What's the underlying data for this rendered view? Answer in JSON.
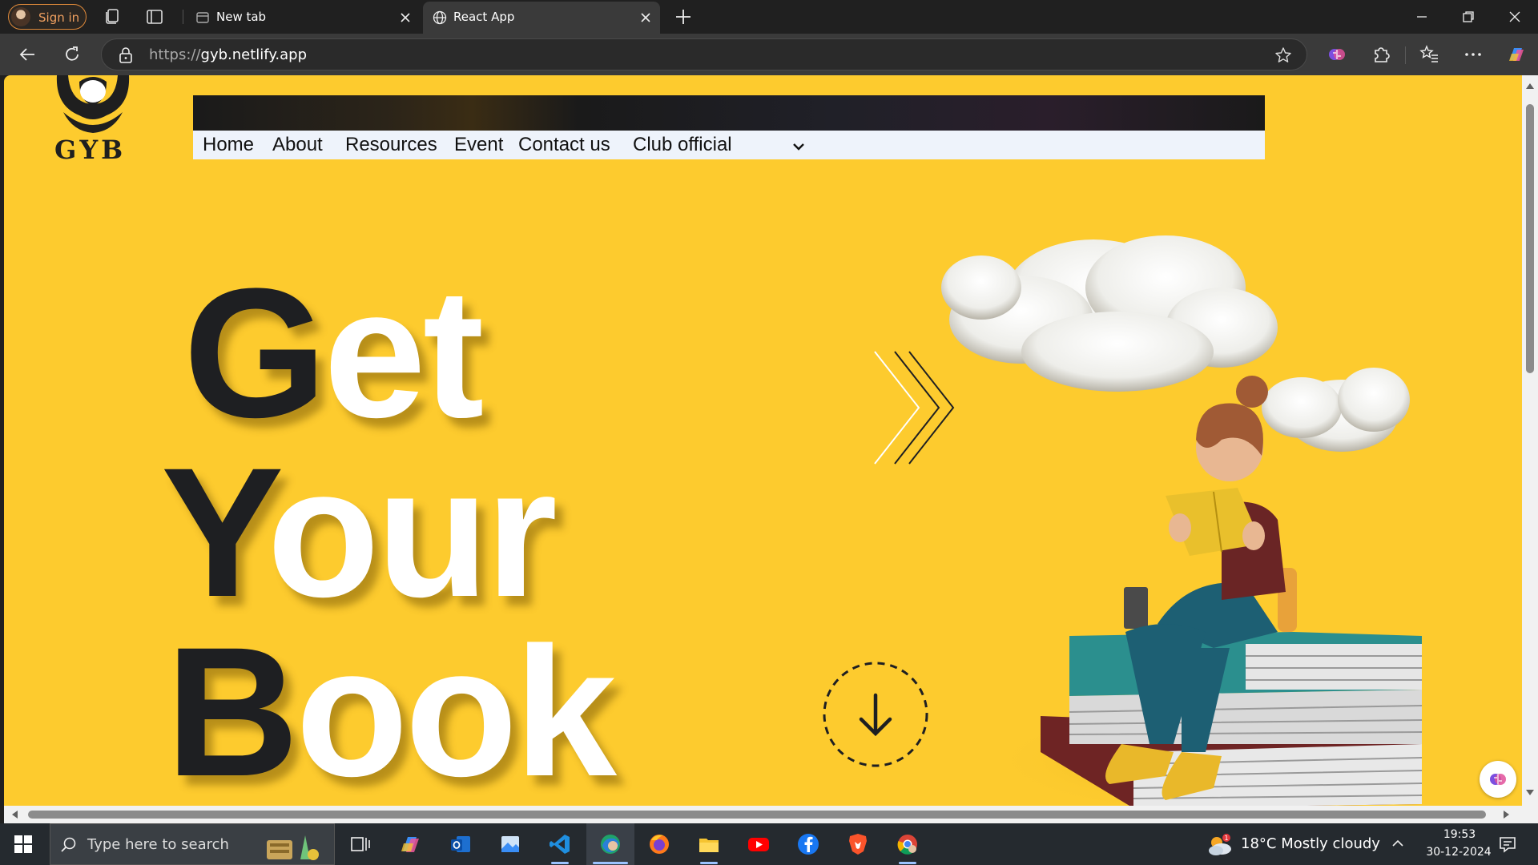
{
  "browser": {
    "signin_label": "Sign in",
    "tabs": [
      {
        "title": "New tab"
      },
      {
        "title": "React App"
      }
    ],
    "url_protocol": "https://",
    "url_host": "gyb.netlify.app"
  },
  "site": {
    "logo_text": "GYB",
    "nav": {
      "home": "Home",
      "about": "About",
      "resources": "Resources",
      "event": "Event",
      "contact": "Contact us",
      "club": "Club official"
    },
    "hero": {
      "get_1": "G",
      "get_2": "et",
      "your_1": "Y",
      "your_2": "our",
      "book_1": "B",
      "book_2": "ook"
    }
  },
  "taskbar": {
    "search_placeholder": "Type here to search",
    "weather": "18°C  Mostly cloudy",
    "time": "19:53",
    "date": "30-12-2024",
    "weather_badge": "1"
  },
  "colors": {
    "page_bg": "#fdcb2e",
    "hero_dark": "#1e1f22",
    "hero_light": "#ffffff",
    "signin_accent": "#e08a3a"
  },
  "icons": [
    "workspaces-icon",
    "tab-actions-icon",
    "globe-icon",
    "close-icon",
    "plus-icon",
    "minimize-icon",
    "restore-icon",
    "back-icon",
    "refresh-icon",
    "lock-icon",
    "star-icon",
    "copilot-icon",
    "extensions-icon",
    "favorites-icon",
    "more-icon",
    "windows-start-icon",
    "search-icon",
    "chevron-down-icon",
    "arrow-down-icon"
  ]
}
